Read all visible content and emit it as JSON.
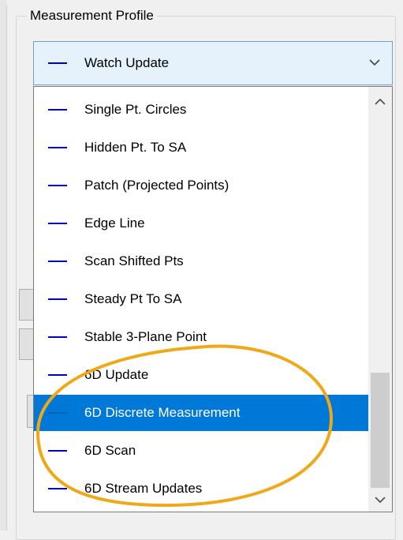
{
  "group": {
    "title": "Measurement Profile"
  },
  "combo": {
    "selected_label": "Watch Update"
  },
  "dropdown": {
    "items": [
      {
        "label": "Single Pt. Circles",
        "selected": false
      },
      {
        "label": "Hidden Pt. To SA",
        "selected": false
      },
      {
        "label": "Patch (Projected Points)",
        "selected": false
      },
      {
        "label": "Edge Line",
        "selected": false
      },
      {
        "label": "Scan Shifted Pts",
        "selected": false
      },
      {
        "label": "Steady Pt To SA",
        "selected": false
      },
      {
        "label": "Stable 3-Plane Point",
        "selected": false
      },
      {
        "label": "6D Update",
        "selected": false
      },
      {
        "label": "6D Discrete Measurement",
        "selected": true
      },
      {
        "label": "6D Scan",
        "selected": false
      },
      {
        "label": "6D Stream Updates",
        "selected": false
      }
    ]
  },
  "colors": {
    "item_line": "#0000c0",
    "selection": "#0078d7",
    "highlight_ellipse": "#f0a818",
    "combo_background": "#e5f1fb"
  },
  "icons": {
    "combo_arrow": "chevron-down-icon",
    "scroll_up": "chevron-up-icon",
    "scroll_down": "chevron-down-icon"
  }
}
